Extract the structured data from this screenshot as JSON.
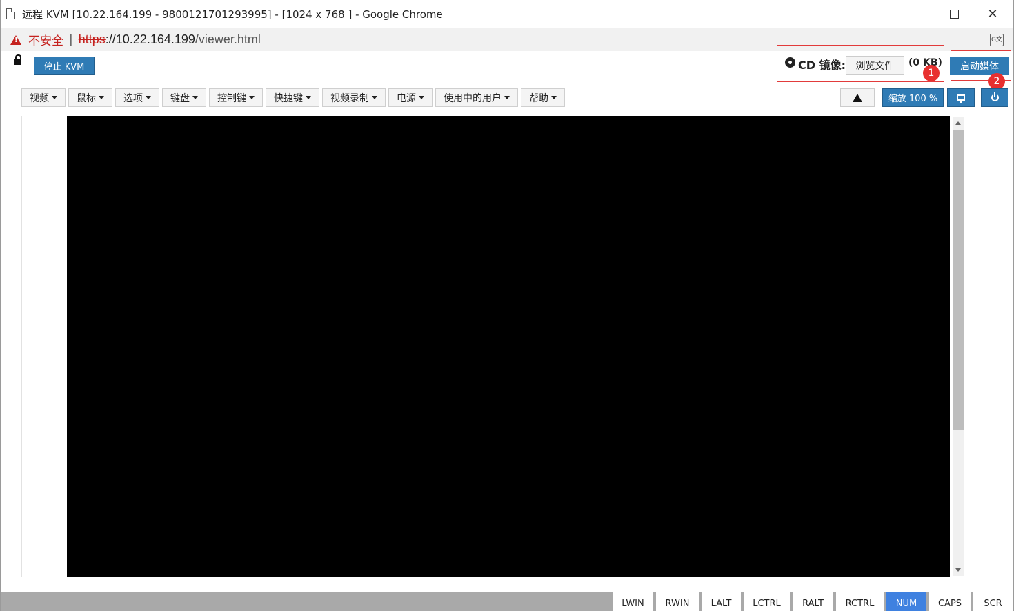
{
  "window": {
    "title": "远程 KVM [10.22.164.199 - 9800121701293995] - [1024 x 768 ] - Google Chrome"
  },
  "addressbar": {
    "insecure_label": "不安全",
    "separator": "|",
    "url_scheme": "https",
    "url_host": "://10.22.164.199",
    "url_path": "/viewer.html"
  },
  "toolbar": {
    "stop_kvm_label": "停止 KVM",
    "cd_label": "CD 镜像:",
    "browse_label": "浏览文件",
    "cd_size": "(0 KB)",
    "start_media_label": "启动媒体",
    "zoom_label": "缩放 100 %"
  },
  "annotations": {
    "marker1": "1",
    "marker2": "2"
  },
  "menus": [
    {
      "label": "视频"
    },
    {
      "label": "鼠标"
    },
    {
      "label": "选项"
    },
    {
      "label": "键盘"
    },
    {
      "label": "控制键"
    },
    {
      "label": "快捷键"
    },
    {
      "label": "视频录制"
    },
    {
      "label": "电源"
    },
    {
      "label": "使用中的用户"
    },
    {
      "label": "帮助"
    }
  ],
  "status_keys": [
    {
      "label": "LWIN",
      "active": false
    },
    {
      "label": "RWIN",
      "active": false
    },
    {
      "label": "LALT",
      "active": false
    },
    {
      "label": "LCTRL",
      "active": false
    },
    {
      "label": "RALT",
      "active": false
    },
    {
      "label": "RCTRL",
      "active": false
    },
    {
      "label": "NUM",
      "active": true
    },
    {
      "label": "CAPS",
      "active": false
    },
    {
      "label": "SCR",
      "active": false
    }
  ],
  "colors": {
    "accent": "#2f7bb5",
    "status_active": "#3f81e0",
    "annotation": "#e8302f"
  }
}
